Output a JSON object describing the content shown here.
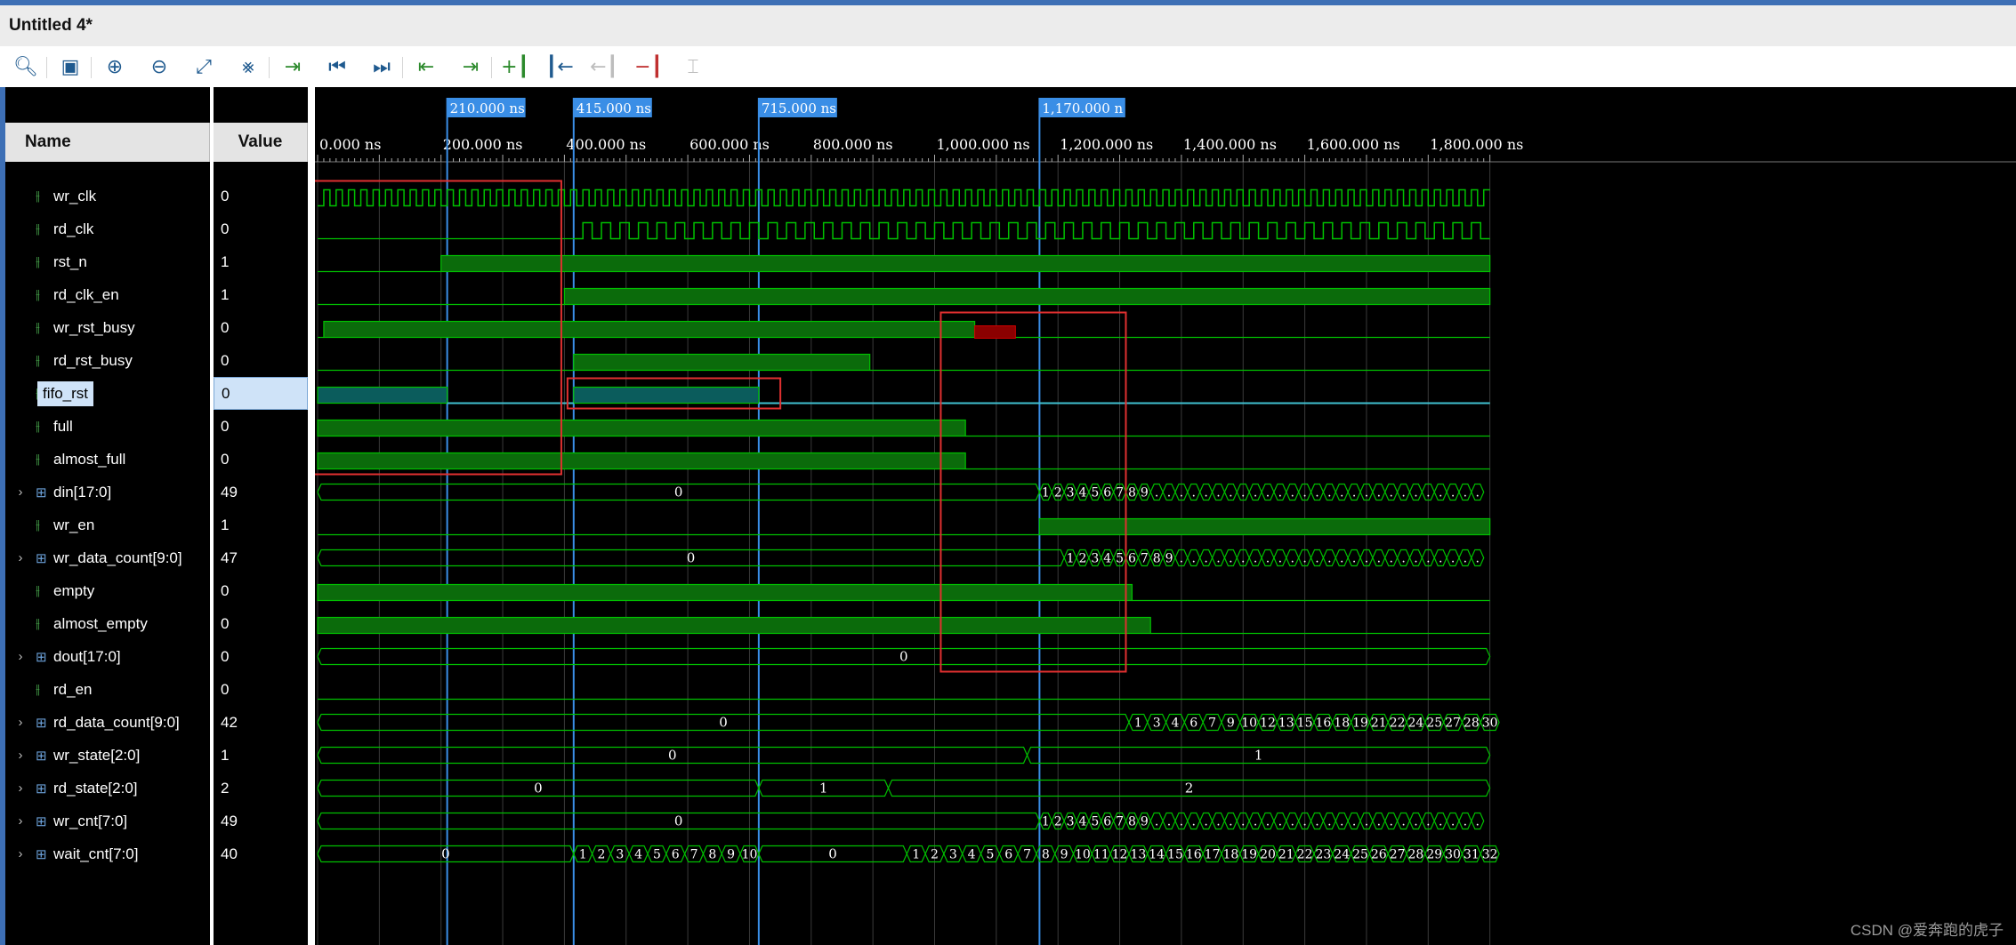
{
  "window": {
    "title": "Untitled 4*"
  },
  "toolbar": {
    "icons": [
      "search-icon",
      "save-icon",
      "zoom-in-icon",
      "zoom-out-icon",
      "zoom-fit-icon",
      "swap-cursor-icon",
      "go-to-cursor-icon",
      "go-to-start-icon",
      "go-to-end-icon",
      "previous-transition-icon",
      "next-transition-icon",
      "add-marker-icon",
      "previous-marker-icon",
      "next-marker-icon",
      "swap-markers-icon",
      "snap-icon"
    ]
  },
  "headers": {
    "name": "Name",
    "value": "Value"
  },
  "signals": [
    {
      "name": "wr_clk",
      "value": "0",
      "bus": false
    },
    {
      "name": "rd_clk",
      "value": "0",
      "bus": false
    },
    {
      "name": "rst_n",
      "value": "1",
      "bus": false
    },
    {
      "name": "rd_clk_en",
      "value": "1",
      "bus": false
    },
    {
      "name": "wr_rst_busy",
      "value": "0",
      "bus": false
    },
    {
      "name": "rd_rst_busy",
      "value": "0",
      "bus": false
    },
    {
      "name": "fifo_rst",
      "value": "0",
      "bus": false,
      "selected": true
    },
    {
      "name": "full",
      "value": "0",
      "bus": false
    },
    {
      "name": "almost_full",
      "value": "0",
      "bus": false
    },
    {
      "name": "din[17:0]",
      "value": "49",
      "bus": true
    },
    {
      "name": "wr_en",
      "value": "1",
      "bus": false
    },
    {
      "name": "wr_data_count[9:0]",
      "value": "47",
      "bus": true
    },
    {
      "name": "empty",
      "value": "0",
      "bus": false
    },
    {
      "name": "almost_empty",
      "value": "0",
      "bus": false
    },
    {
      "name": "dout[17:0]",
      "value": "0",
      "bus": true
    },
    {
      "name": "rd_en",
      "value": "0",
      "bus": false
    },
    {
      "name": "rd_data_count[9:0]",
      "value": "42",
      "bus": true
    },
    {
      "name": "wr_state[2:0]",
      "value": "1",
      "bus": true
    },
    {
      "name": "rd_state[2:0]",
      "value": "2",
      "bus": true
    },
    {
      "name": "wr_cnt[7:0]",
      "value": "49",
      "bus": true
    },
    {
      "name": "wait_cnt[7:0]",
      "value": "40",
      "bus": true
    }
  ],
  "timeline": {
    "ticks": [
      "0.000 ns",
      "200.000 ns",
      "400.000 ns",
      "600.000 ns",
      "800.000 ns",
      "1,000.000 ns",
      "1,200.000 ns",
      "1,400.000 ns",
      "1,600.000 ns",
      "1,800.000 ns"
    ],
    "markers": [
      "210.000 ns",
      "415.000 ns",
      "715.000 ns",
      "1,170.000 n"
    ]
  },
  "bus_labels": {
    "din": "0",
    "wr_data_count": "0",
    "dout": "0",
    "rd_data_count": "0",
    "wr_state": [
      "0",
      "1"
    ],
    "rd_state": [
      "0",
      "1",
      "2"
    ],
    "wr_cnt": "0",
    "wait_cnt": [
      "0",
      "0"
    ],
    "count_1_9": [
      "1",
      "2",
      "3",
      "4",
      "5",
      "6",
      "7",
      "8",
      "9"
    ],
    "wait_a": [
      "1",
      "2",
      "3",
      "4",
      "5",
      "6",
      "7",
      "8",
      "9",
      "10"
    ],
    "wait_b": [
      "1",
      "2",
      "3",
      "4",
      "5",
      "6",
      "7",
      "8",
      "9",
      "10",
      "11",
      "12",
      "13",
      "14",
      "15",
      "16",
      "17",
      "18",
      "19",
      "20",
      "21",
      "22",
      "23",
      "24",
      "25",
      "26",
      "27",
      "28",
      "29",
      "30",
      "31",
      "32"
    ],
    "rd_count": [
      "1",
      "3",
      "4",
      "6",
      "7",
      "9",
      "10",
      "12",
      "13",
      "15",
      "16",
      "18",
      "19",
      "21",
      "22",
      "24",
      "25",
      "27",
      "28",
      "30"
    ]
  },
  "colors": {
    "wave": "#00c000",
    "fill": "#0b6b0b",
    "cursor": "#3a8ee6",
    "highlight": "#e03030",
    "reset": "#40c0d0"
  },
  "watermark": "CSDN @爱奔跑的虎子"
}
